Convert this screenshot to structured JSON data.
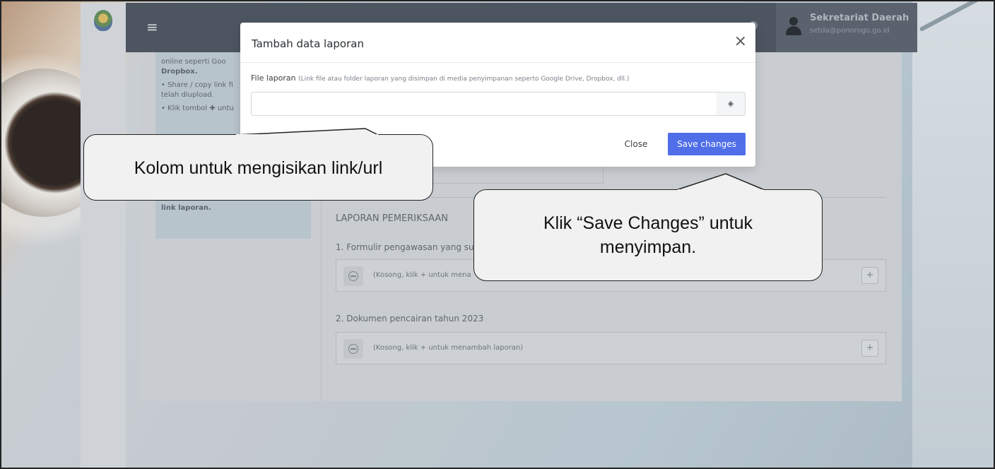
{
  "app": {
    "user_name": "Sekretariat Daerah",
    "user_email": "setda@ponorogo.go.id"
  },
  "info_panel": {
    "lines": [
      "online seperti Goo",
      "Dropbox.",
      "• Share / copy link fi",
      "telah diupload.",
      "• Klik tombol ✚ untu",
      "link laporan."
    ]
  },
  "main": {
    "section_title": "LAPORAN PEMERIKSAAN",
    "items": [
      {
        "label": "1. Formulir pengawasan yang su",
        "empty_text": "(Kosong, klik + untuk mena",
        "add_label": "+"
      },
      {
        "label": "2. Dokumen pencairan tahun 2023",
        "empty_text": "(Kosong, klik + untuk menambah laporan)",
        "add_label": "+"
      }
    ]
  },
  "modal": {
    "title": "Tambah data laporan",
    "close_icon": "×",
    "field_label": "File laporan",
    "field_hint": "(Link file atau folder laporan yang disimpan di media penyimpanan seperto Google Drive, Dropbox, dll.)",
    "input_value": "",
    "input_placeholder": "",
    "clear_icon": "eraser-icon",
    "clear_glyph": "◈",
    "close_button": "Close",
    "save_button": "Save changes"
  },
  "callouts": {
    "input_hint": "Kolom untuk mengisikan link/url",
    "save_hint_line1": "Klik “Save Changes” untuk",
    "save_hint_line2": "menyimpan."
  }
}
